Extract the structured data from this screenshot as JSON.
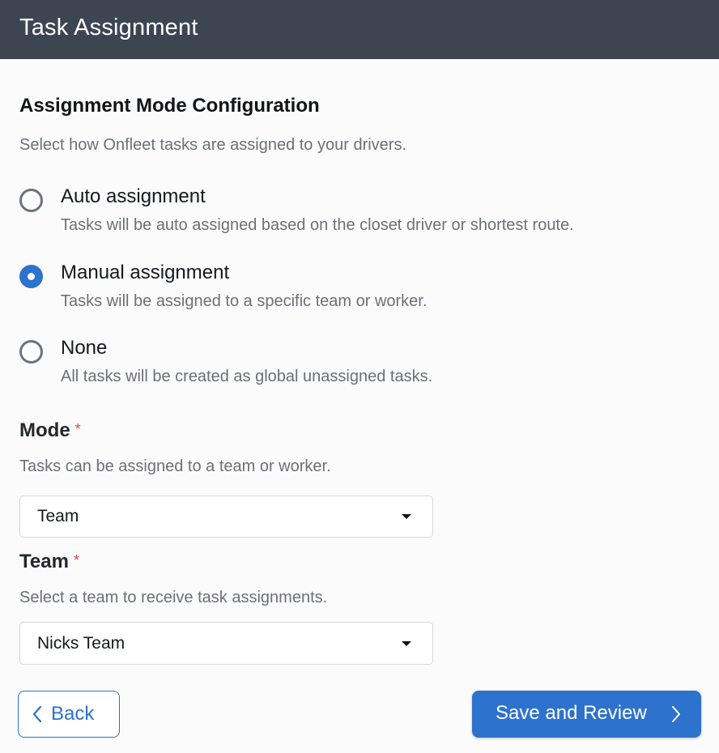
{
  "header": {
    "title": "Task Assignment"
  },
  "assignment_mode": {
    "title": "Assignment Mode Configuration",
    "description": "Select how Onfleet tasks are assigned to your drivers.",
    "options": [
      {
        "label": "Auto assignment",
        "description": "Tasks will be auto assigned based on the closet driver or shortest route.",
        "selected": false
      },
      {
        "label": "Manual assignment",
        "description": "Tasks will be assigned to a specific team or worker.",
        "selected": true
      },
      {
        "label": "None",
        "description": "All tasks will be created as global unassigned tasks.",
        "selected": false
      }
    ]
  },
  "mode_field": {
    "label": "Mode",
    "required_marker": "*",
    "description": "Tasks can be assigned to a team or worker.",
    "selected_value": "Team"
  },
  "team_field": {
    "label": "Team",
    "required_marker": "*",
    "description": "Select a team to receive task assignments.",
    "selected_value": "Nicks Team"
  },
  "footer": {
    "back_label": "Back",
    "save_label": "Save and Review"
  },
  "colors": {
    "header_bg": "#3d4553",
    "primary": "#2d72cc",
    "required": "#e0443e"
  },
  "icons": {
    "back": "chevron-left-icon",
    "save": "chevron-right-icon",
    "dropdown": "caret-down-icon"
  }
}
